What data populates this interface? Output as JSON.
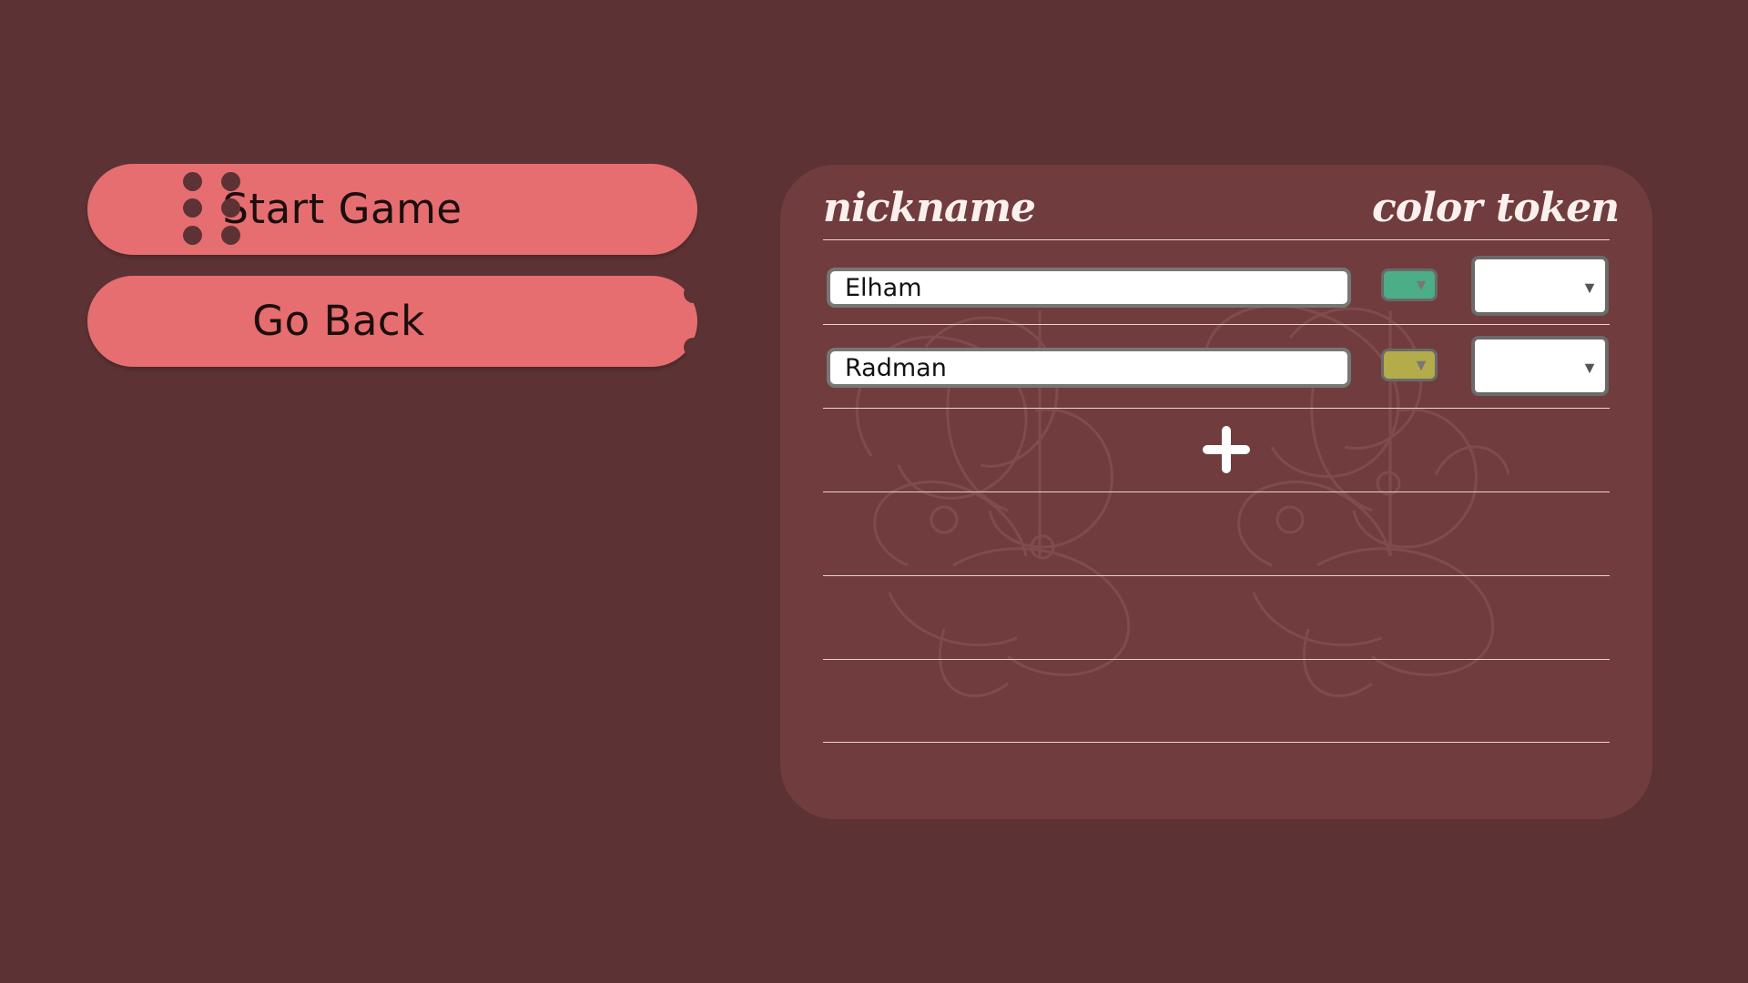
{
  "menu": {
    "start_label": "Start Game",
    "back_label": "Go Back"
  },
  "table": {
    "headers": {
      "nickname": "nickname",
      "color": "color",
      "token": "token"
    },
    "players": [
      {
        "nickname": "Elham",
        "color": "#4bae86",
        "token": ""
      },
      {
        "nickname": "Radman",
        "color": "#b4ab4b",
        "token": ""
      }
    ]
  },
  "colors": {
    "background": "#5c3234",
    "panel": "#713c3d",
    "button": "#e66e70"
  },
  "icons": {
    "add": "plus-icon",
    "dropdown": "caret-down-icon"
  }
}
